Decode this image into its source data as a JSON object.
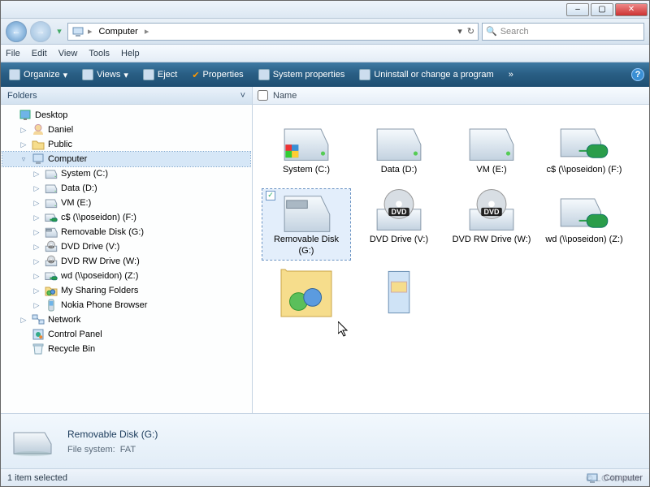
{
  "titlebar": {
    "min": "–",
    "max": "▢",
    "close": "✕"
  },
  "nav": {
    "back_glyph": "←",
    "fwd_glyph": "→",
    "history_glyph": "▾",
    "crumb_root_icon": "💻",
    "crumb_location": "Computer",
    "crumb_sep": "▸",
    "addr_dd": "▾",
    "refresh": "↻"
  },
  "search": {
    "placeholder": "Search",
    "icon": "🔍"
  },
  "menubar": [
    "File",
    "Edit",
    "View",
    "Tools",
    "Help"
  ],
  "cmdbar": {
    "items": [
      {
        "label": "Organize",
        "dd": "▾"
      },
      {
        "label": "Views",
        "dd": "▾"
      },
      {
        "label": "Eject"
      },
      {
        "label": "Properties"
      },
      {
        "label": "System properties"
      },
      {
        "label": "Uninstall or change a program"
      }
    ],
    "overflow": "»",
    "help": "?"
  },
  "sidebar": {
    "header": "Folders",
    "chev": "˅",
    "nodes": [
      {
        "ind": 0,
        "tw": "",
        "icon": "desktop",
        "label": "Desktop"
      },
      {
        "ind": 1,
        "tw": "▷",
        "icon": "user",
        "label": "Daniel"
      },
      {
        "ind": 1,
        "tw": "▷",
        "icon": "folder",
        "label": "Public"
      },
      {
        "ind": 1,
        "tw": "▿",
        "icon": "computer",
        "label": "Computer",
        "sel": true
      },
      {
        "ind": 2,
        "tw": "▷",
        "icon": "hdd",
        "label": "System (C:)"
      },
      {
        "ind": 2,
        "tw": "▷",
        "icon": "hdd",
        "label": "Data (D:)"
      },
      {
        "ind": 2,
        "tw": "▷",
        "icon": "hdd",
        "label": "VM (E:)"
      },
      {
        "ind": 2,
        "tw": "▷",
        "icon": "netdrv",
        "label": "c$ (\\\\poseidon) (F:)"
      },
      {
        "ind": 2,
        "tw": "▷",
        "icon": "usb",
        "label": "Removable Disk (G:)"
      },
      {
        "ind": 2,
        "tw": "▷",
        "icon": "dvd",
        "label": "DVD Drive (V:)"
      },
      {
        "ind": 2,
        "tw": "▷",
        "icon": "dvd",
        "label": "DVD RW Drive (W:)"
      },
      {
        "ind": 2,
        "tw": "▷",
        "icon": "netdrv",
        "label": "wd (\\\\poseidon) (Z:)"
      },
      {
        "ind": 2,
        "tw": "▷",
        "icon": "share",
        "label": "My Sharing Folders"
      },
      {
        "ind": 2,
        "tw": "▷",
        "icon": "phone",
        "label": "Nokia Phone Browser"
      },
      {
        "ind": 1,
        "tw": "▷",
        "icon": "network",
        "label": "Network"
      },
      {
        "ind": 1,
        "tw": "",
        "icon": "cpanel",
        "label": "Control Panel"
      },
      {
        "ind": 1,
        "tw": "",
        "icon": "bin",
        "label": "Recycle Bin"
      }
    ]
  },
  "columns": {
    "name": "Name"
  },
  "drives": [
    {
      "icon": "hdd-sys",
      "label": "System (C:)"
    },
    {
      "icon": "hdd",
      "label": "Data (D:)"
    },
    {
      "icon": "hdd",
      "label": "VM (E:)"
    },
    {
      "icon": "netdrv",
      "label": "c$ (\\\\poseidon) (F:)"
    },
    {
      "icon": "usb",
      "label": "Removable Disk (G:)",
      "sel": true
    },
    {
      "icon": "dvd",
      "label": "DVD Drive (V:)"
    },
    {
      "icon": "dvd",
      "label": "DVD RW Drive (W:)"
    },
    {
      "icon": "netdrv",
      "label": "wd (\\\\poseidon) (Z:)"
    },
    {
      "icon": "share",
      "label": ""
    },
    {
      "icon": "cpanel-item",
      "label": ""
    }
  ],
  "details": {
    "name": "Removable Disk (G:)",
    "fs_label": "File system:",
    "fs_value": "FAT"
  },
  "status": {
    "left": "1 item selected",
    "right_label": "Computer"
  },
  "watermark": "© LO4D.com",
  "check": "✓"
}
